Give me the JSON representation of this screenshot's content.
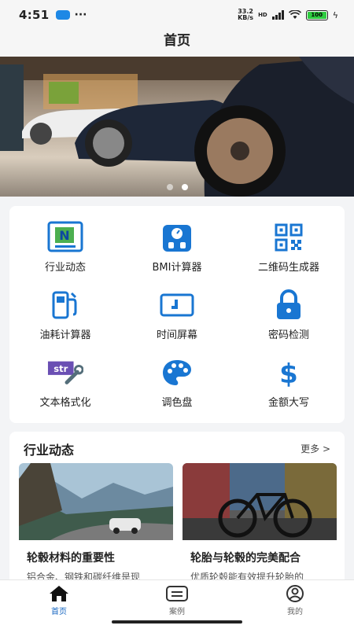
{
  "status_bar": {
    "time": "4:51",
    "speed_value": "33.2",
    "speed_unit": "KB/s",
    "network": "HD",
    "battery": "100"
  },
  "page_title": "首页",
  "banner": {
    "slides": 2,
    "active_slide": 2
  },
  "tools": [
    {
      "label": "行业动态",
      "icon": "news-icon",
      "glyph": "N"
    },
    {
      "label": "BMI计算器",
      "icon": "scale-icon"
    },
    {
      "label": "二维码生成器",
      "icon": "qr-code-icon"
    },
    {
      "label": "油耗计算器",
      "icon": "fuel-pump-icon"
    },
    {
      "label": "时间屏幕",
      "icon": "clock-screen-icon"
    },
    {
      "label": "密码检测",
      "icon": "lock-icon"
    },
    {
      "label": "文本格式化",
      "icon": "text-format-icon",
      "glyph": "str"
    },
    {
      "label": "调色盘",
      "icon": "palette-icon"
    },
    {
      "label": "金额大写",
      "icon": "dollar-icon",
      "glyph": "$"
    }
  ],
  "news": {
    "title": "行业动态",
    "more": "更多 >",
    "articles": [
      {
        "title": "轮毂材料的重要性",
        "desc": "铝合金、钢铁和碳纤维是现"
      },
      {
        "title": "轮胎与轮毂的完美配合",
        "desc": "优质轮毂能有效提升轮胎的"
      }
    ]
  },
  "bottom_nav": [
    {
      "label": "首页",
      "icon": "home-icon",
      "active": true
    },
    {
      "label": "案例",
      "icon": "list-icon",
      "active": false
    },
    {
      "label": "我的",
      "icon": "user-icon",
      "active": false
    }
  ],
  "colors": {
    "accent": "#1565c0",
    "icon_blue": "#1976d2",
    "battery": "#2ecc40"
  }
}
